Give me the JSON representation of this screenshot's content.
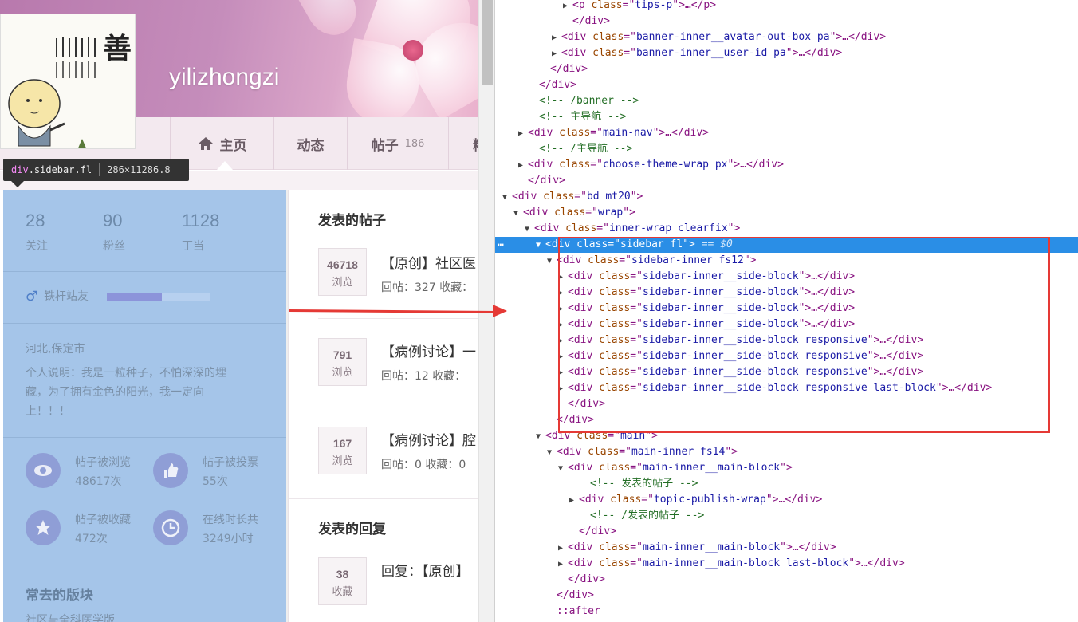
{
  "profile": {
    "username": "yilizhongzi",
    "avatar_calligraphy": "善"
  },
  "nav": {
    "home": "主页",
    "activity": "动态",
    "posts": "帖子",
    "posts_count": "186",
    "more": "精"
  },
  "tooltip": {
    "tag": "div",
    "cls": ".sidebar.fl",
    "size": "286×11286.8"
  },
  "sidebar": {
    "stats": [
      {
        "num": "28",
        "label": "关注"
      },
      {
        "num": "90",
        "label": "粉丝"
      },
      {
        "num": "1128",
        "label": "丁当"
      }
    ],
    "level": "铁杆站友",
    "level_progress": 0.53,
    "location": "河北,保定市",
    "bio_line1": "个人说明：我是一粒种子，不怕深深的埋",
    "bio_line2": "藏，为了拥有金色的阳光，我一定向",
    "bio_line3": "上！！！",
    "metrics": [
      {
        "title": "帖子被浏览",
        "value": "48617次"
      },
      {
        "title": "帖子被投票",
        "value": "55次"
      },
      {
        "title": "帖子被收藏",
        "value": "472次"
      },
      {
        "title": "在线时长共",
        "value": "3249小时"
      }
    ],
    "frequent_title": "常去的版块",
    "frequent_first": "社区与全科医学版"
  },
  "main": {
    "posts_title": "发表的帖子",
    "posts": [
      {
        "count": "46718",
        "unit": "浏览",
        "title": "【原创】社区医",
        "meta": "回帖：327   收藏："
      },
      {
        "count": "791",
        "unit": "浏览",
        "title": "【病例讨论】一",
        "meta": "回帖：12   收藏："
      },
      {
        "count": "167",
        "unit": "浏览",
        "title": "【病例讨论】腔",
        "meta": "回帖：0   收藏：0"
      }
    ],
    "replies_title": "发表的回复",
    "replies": [
      {
        "count": "38",
        "unit": "收藏",
        "title": "回复：【原创】"
      }
    ]
  },
  "devtools": {
    "selected_suffix": "== $0",
    "after": "::after",
    "comments": {
      "banner_end": "<!-- /banner -->",
      "main_nav": "<!-- 主导航 -->",
      "main_nav_end": "<!-- /主导航 -->",
      "posts": "<!-- 发表的帖子 -->",
      "posts_end": "<!-- /发表的帖子 -->"
    }
  },
  "colors": {
    "highlight": "#a5c5e9",
    "selection": "#2a8ee6",
    "annotation": "#e53935"
  }
}
